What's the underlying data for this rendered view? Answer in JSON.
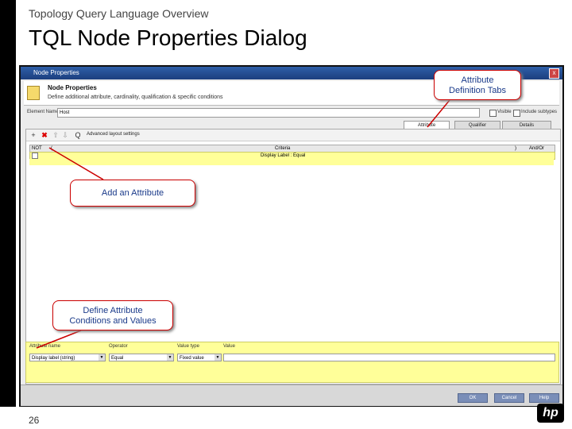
{
  "slide": {
    "subtitle": "Topology Query Language Overview",
    "title": "TQL Node Properties Dialog",
    "number": "26",
    "logo_text": "hp"
  },
  "dialog": {
    "window_title": "Node Properties",
    "close_glyph": "x",
    "heading": "Node Properties",
    "description": "Define additional attribute, cardinality, qualification & specific conditions",
    "name_label": "Element Name:",
    "name_value": "Host",
    "visible_label": "Visible",
    "include_label": "Include subtypes",
    "tabs": [
      "Attribute",
      "Qualifier",
      "Details"
    ],
    "toolbar": {
      "add_glyph": "+",
      "remove_glyph": "✖",
      "up_glyph": "⇧",
      "down_glyph": "⇩",
      "search_glyph": "Q",
      "advanced_label": "Advanced layout settings"
    },
    "table": {
      "headers": [
        "NOT",
        "(",
        "Criteria",
        ")",
        "And/Or"
      ],
      "row_value": "Display Label : Equal"
    },
    "conditions": {
      "attr_label": "Attribute name",
      "attr_value": "Display label  (string)",
      "op_label": "Operator",
      "op_value": "Equal",
      "type_label": "Value type",
      "type_value": "Fixed value",
      "val_label": "Value"
    },
    "buttons": {
      "ok": "OK",
      "cancel": "Cancel",
      "help": "Help"
    }
  },
  "callouts": {
    "attr_tabs_line1": "Attribute",
    "attr_tabs_line2": "Definition Tabs",
    "add_attr": "Add an Attribute",
    "define_line1": "Define Attribute",
    "define_line2": "Conditions and Values"
  },
  "colors": {
    "callout_border": "#cc0000",
    "callout_text": "#1a3a8a",
    "highlight": "#ffff99"
  }
}
